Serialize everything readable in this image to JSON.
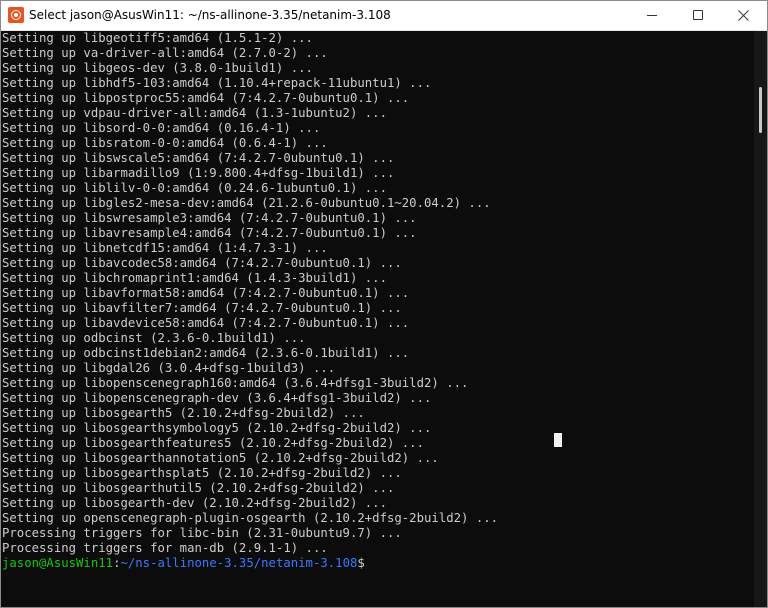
{
  "window": {
    "title": "Select jason@AsusWin11: ~/ns-allinone-3.35/netanim-3.108",
    "app_icon": "ubuntu-icon",
    "controls": [
      "minimize-icon",
      "maximize-icon",
      "close-icon"
    ]
  },
  "terminal": {
    "lines": [
      "Setting up libgeotiff5:amd64 (1.5.1-2) ...",
      "Setting up va-driver-all:amd64 (2.7.0-2) ...",
      "Setting up libgeos-dev (3.8.0-1build1) ...",
      "Setting up libhdf5-103:amd64 (1.10.4+repack-11ubuntu1) ...",
      "Setting up libpostproc55:amd64 (7:4.2.7-0ubuntu0.1) ...",
      "Setting up vdpau-driver-all:amd64 (1.3-1ubuntu2) ...",
      "Setting up libsord-0-0:amd64 (0.16.4-1) ...",
      "Setting up libsratom-0-0:amd64 (0.6.4-1) ...",
      "Setting up libswscale5:amd64 (7:4.2.7-0ubuntu0.1) ...",
      "Setting up libarmadillo9 (1:9.800.4+dfsg-1build1) ...",
      "Setting up liblilv-0-0:amd64 (0.24.6-1ubuntu0.1) ...",
      "Setting up libgles2-mesa-dev:amd64 (21.2.6-0ubuntu0.1~20.04.2) ...",
      "Setting up libswresample3:amd64 (7:4.2.7-0ubuntu0.1) ...",
      "Setting up libavresample4:amd64 (7:4.2.7-0ubuntu0.1) ...",
      "Setting up libnetcdf15:amd64 (1:4.7.3-1) ...",
      "Setting up libavcodec58:amd64 (7:4.2.7-0ubuntu0.1) ...",
      "Setting up libchromaprint1:amd64 (1.4.3-3build1) ...",
      "Setting up libavformat58:amd64 (7:4.2.7-0ubuntu0.1) ...",
      "Setting up libavfilter7:amd64 (7:4.2.7-0ubuntu0.1) ...",
      "Setting up libavdevice58:amd64 (7:4.2.7-0ubuntu0.1) ...",
      "Setting up odbcinst (2.3.6-0.1build1) ...",
      "Setting up odbcinst1debian2:amd64 (2.3.6-0.1build1) ...",
      "Setting up libgdal26 (3.0.4+dfsg-1build3) ...",
      "Setting up libopenscenegraph160:amd64 (3.6.4+dfsg1-3build2) ...",
      "Setting up libopenscenegraph-dev (3.6.4+dfsg1-3build2) ...",
      "Setting up libosgearth5 (2.10.2+dfsg-2build2) ...",
      "Setting up libosgearthsymbology5 (2.10.2+dfsg-2build2) ...",
      "Setting up libosgearthfeatures5 (2.10.2+dfsg-2build2) ...",
      "Setting up libosgearthannotation5 (2.10.2+dfsg-2build2) ...",
      "Setting up libosgearthsplat5 (2.10.2+dfsg-2build2) ...",
      "Setting up libosgearthutil5 (2.10.2+dfsg-2build2) ...",
      "Setting up libosgearth-dev (2.10.2+dfsg-2build2) ...",
      "Setting up openscenegraph-plugin-osgearth (2.10.2+dfsg-2build2) ...",
      "Processing triggers for libc-bin (2.31-0ubuntu9.7) ...",
      "Processing triggers for man-db (2.9.1-1) ..."
    ],
    "prompt": {
      "user_host": "jason@AsusWin11",
      "separator": ":",
      "path": "~/ns-allinone-3.35/netanim-3.108",
      "symbol": "$"
    }
  },
  "colors": {
    "background": "#0c0c0c",
    "text": "#cccccc",
    "prompt_user": "#16c60c",
    "prompt_path": "#3b78ff"
  }
}
